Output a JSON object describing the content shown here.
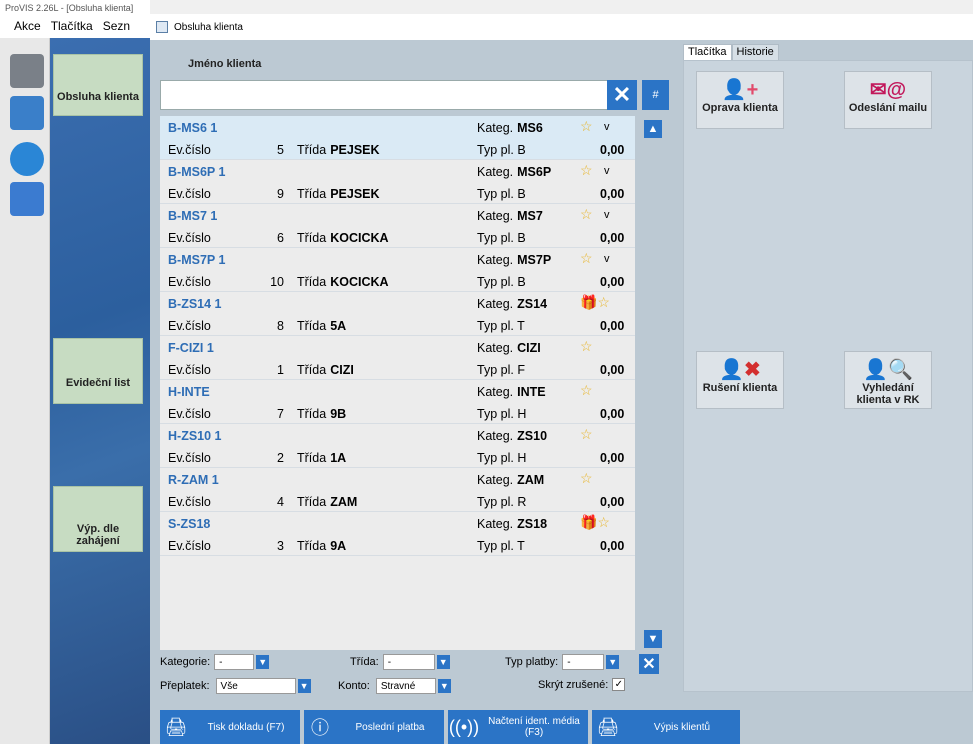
{
  "bg": {
    "title": "ProVIS 2.26L - [Obsluha klienta]",
    "menu": [
      "Akce",
      "Tlačítka",
      "Sezn"
    ],
    "panel_buttons": [
      {
        "label": "Obsluha klienta"
      },
      {
        "label": "Evideční list"
      },
      {
        "label": "Výp. dle zahájení"
      }
    ]
  },
  "dialog": {
    "title": "Obsluha klienta",
    "client_label": "Jméno klienta",
    "search": {
      "value": "",
      "placeholder": ""
    },
    "hash": "#",
    "list_labels": {
      "kateg": "Kateg.",
      "ev": "Ev.číslo",
      "trida": "Třída",
      "typ": "Typ pl."
    },
    "items": [
      {
        "code": "B-MS6 1",
        "kateg": "MS6",
        "ev": "5",
        "trida": "PEJSEK",
        "typ": "B",
        "amount": "0,00",
        "v": "v",
        "gift": ""
      },
      {
        "code": "B-MS6P 1",
        "kateg": "MS6P",
        "ev": "9",
        "trida": "PEJSEK",
        "typ": "B",
        "amount": "0,00",
        "v": "v",
        "gift": ""
      },
      {
        "code": "B-MS7 1",
        "kateg": "MS7",
        "ev": "6",
        "trida": "KOCICKA",
        "typ": "B",
        "amount": "0,00",
        "v": "v",
        "gift": ""
      },
      {
        "code": "B-MS7P 1",
        "kateg": "MS7P",
        "ev": "10",
        "trida": "KOCICKA",
        "typ": "B",
        "amount": "0,00",
        "v": "v",
        "gift": ""
      },
      {
        "code": "B-ZS14 1",
        "kateg": "ZS14",
        "ev": "8",
        "trida": "5A",
        "typ": "T",
        "amount": "0,00",
        "v": "",
        "gift": "gift-icon"
      },
      {
        "code": "F-CIZI 1",
        "kateg": "CIZI",
        "ev": "1",
        "trida": "CIZI",
        "typ": "F",
        "amount": "0,00",
        "v": "",
        "gift": ""
      },
      {
        "code": "H-INTE",
        "kateg": "INTE",
        "ev": "7",
        "trida": "9B",
        "typ": "H",
        "amount": "0,00",
        "v": "",
        "gift": ""
      },
      {
        "code": "H-ZS10 1",
        "kateg": "ZS10",
        "ev": "2",
        "trida": "1A",
        "typ": "H",
        "amount": "0,00",
        "v": "",
        "gift": ""
      },
      {
        "code": "R-ZAM 1",
        "kateg": "ZAM",
        "ev": "4",
        "trida": "ZAM",
        "typ": "R",
        "amount": "0,00",
        "v": "",
        "gift": ""
      },
      {
        "code": "S-ZS18",
        "kateg": "ZS18",
        "ev": "3",
        "trida": "9A",
        "typ": "T",
        "amount": "0,00",
        "v": "",
        "gift": "gift-icon"
      }
    ],
    "filters": {
      "kategorie_label": "Kategorie:",
      "kategorie_value": "-",
      "trida_label": "Třída:",
      "trida_value": "-",
      "typ_label": "Typ platby:",
      "typ_value": "-",
      "preplatek_label": "Přeplatek:",
      "preplatek_value": "Vše",
      "konto_label": "Konto:",
      "konto_value": "Stravné",
      "skryt_label": "Skrýt zrušené:",
      "skryt_checked": "✓"
    },
    "bottom_buttons": [
      {
        "label": "Tisk dokladu (F7)",
        "icon": "printer-icon"
      },
      {
        "label": "Poslední platba",
        "icon": "info-icon"
      },
      {
        "label": "Načtení ident. média (F3)",
        "icon": "rfid-icon"
      },
      {
        "label": "Výpis klientů",
        "icon": "printer-icon"
      }
    ],
    "tabs": [
      "Tlačítka",
      "Historie"
    ],
    "action_buttons": [
      {
        "label": "Oprava klienta",
        "icon": "edit-user-icon"
      },
      {
        "label": "Odeslání mailu",
        "icon": "mail-icon"
      },
      {
        "label": "Rušení klienta",
        "icon": "delete-user-icon"
      },
      {
        "label": "Vyhledání klienta v RK",
        "icon": "search-user-icon"
      }
    ]
  },
  "colors": {
    "accent": "#2b74c6",
    "code": "#2e6db5",
    "selected": "#daeaf5",
    "star": "#e8b52a"
  }
}
